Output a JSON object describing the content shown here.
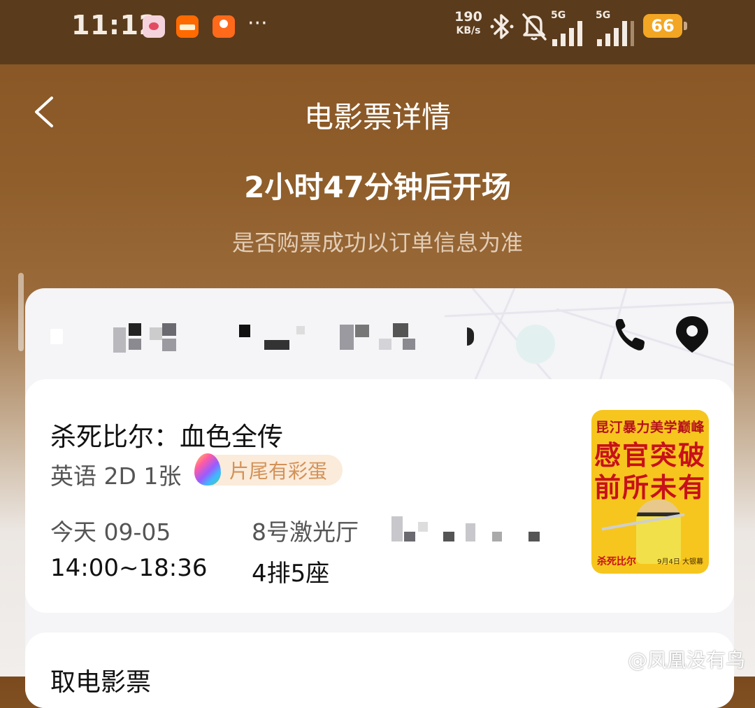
{
  "status_bar": {
    "time": "11:12",
    "more": "···",
    "net_speed_value": "190",
    "net_speed_unit": "KB/s",
    "sim1_label": "5G",
    "sim2_label": "5G",
    "battery": "66"
  },
  "header": {
    "title": "电影票详情",
    "countdown": "2小时47分钟后开场",
    "notice": "是否购票成功以订单信息为准"
  },
  "ticket": {
    "movie_title": "杀死比尔：血色全传",
    "meta": "英语 2D 1张",
    "easter_egg_badge": "片尾有彩蛋",
    "date": "今天 09-05",
    "time_range": "14:00~18:36",
    "hall": "8号激光厅",
    "seat": "4排5座",
    "poster": {
      "tagline": "昆汀暴力美学巅峰",
      "line1": "感官突破",
      "line2": "前所未有",
      "title": "杀死比尔",
      "release": "9月4日 大银幕"
    }
  },
  "collect_section": {
    "title": "取电影票"
  },
  "watermark": "@凤凰没有鸟",
  "colors": {
    "header_bg": "#8a5826",
    "badge_bg": "#fbebda",
    "badge_text": "#d39258",
    "battery": "#f2a623",
    "poster_bg": "#f6c61e",
    "poster_red": "#c8101b"
  }
}
